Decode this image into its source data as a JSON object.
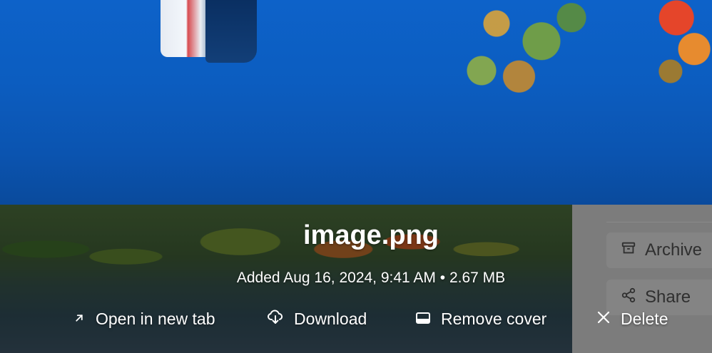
{
  "file": {
    "name": "image.png",
    "added_label": "Added Aug 16, 2024, 9:41 AM",
    "separator": "•",
    "size": "2.67 MB"
  },
  "actions": [
    {
      "label": "Open in new tab",
      "icon": "arrow-up-right-icon"
    },
    {
      "label": "Download",
      "icon": "cloud-download-icon"
    },
    {
      "label": "Remove cover",
      "icon": "cover-icon"
    },
    {
      "label": "Delete",
      "icon": "close-icon"
    }
  ],
  "side_panel": {
    "archive_label": "Archive",
    "share_label": "Share"
  },
  "colors": {
    "text": "#ffffff",
    "panel_bg": "#7c7c7c",
    "panel_text": "#2f2f2f"
  }
}
